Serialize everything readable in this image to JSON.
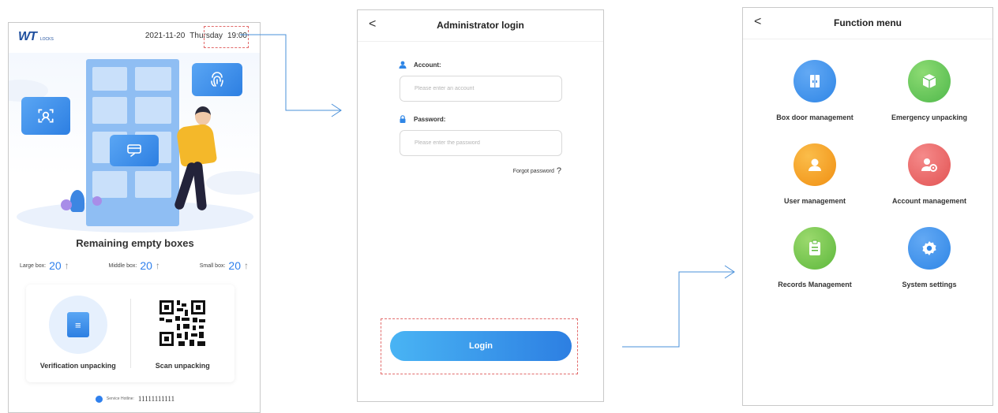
{
  "home": {
    "brand": "WT",
    "brand_sub": "LOCKS",
    "date": "2021-11-20",
    "weekday": "Thursday",
    "time": "19:00",
    "remaining_title": "Remaining empty boxes",
    "boxes": [
      {
        "label": "Large box:",
        "count": "20"
      },
      {
        "label": "Middle box:",
        "count": "20"
      },
      {
        "label": "Small box:",
        "count": "20"
      }
    ],
    "verify_label": "Verification unpacking",
    "scan_label": "Scan unpacking",
    "hotline_label": "Service Hotline:",
    "hotline_number": "11111111111"
  },
  "login": {
    "title": "Administrator login",
    "account_label": "Account:",
    "account_placeholder": "Please enter an account",
    "password_label": "Password:",
    "password_placeholder": "Please enter the password",
    "forgot": "Forgot password",
    "forgot_mark": "?",
    "login_button": "Login"
  },
  "menu": {
    "title": "Function menu",
    "items": [
      {
        "label": "Box door management",
        "color": "#2f86e6",
        "icon": "door-icon"
      },
      {
        "label": "Emergency unpacking",
        "color": "#5cc45a",
        "icon": "box-icon"
      },
      {
        "label": "User management",
        "color": "#f59a1b",
        "icon": "user-icon"
      },
      {
        "label": "Account management",
        "color": "#e85e5e",
        "icon": "user-gear-icon"
      },
      {
        "label": "Records Management",
        "color": "#6cc24a",
        "icon": "clipboard-icon"
      },
      {
        "label": "System settings",
        "color": "#2f86e6",
        "icon": "gear-icon"
      }
    ]
  },
  "back_glyph": "<",
  "colors": {
    "accent": "#2f80ed",
    "highlight": "#e26b6b",
    "connector": "#4a90d9"
  }
}
